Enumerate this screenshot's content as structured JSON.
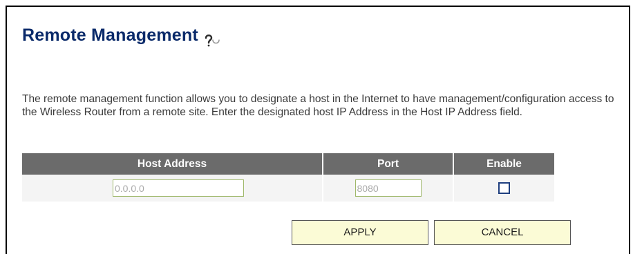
{
  "header": {
    "title": "Remote Management",
    "help_icon": "help-icon"
  },
  "description": "The remote management function allows you to designate a host in the Internet to have management/configuration access to the Wireless Router from a remote site. Enter the designated host IP Address in the Host IP Address field.",
  "table": {
    "columns": [
      "Host Address",
      "Port",
      "Enable"
    ],
    "row": {
      "host_address": "0.0.0.0",
      "port": "8080",
      "enabled": false
    }
  },
  "buttons": {
    "apply_label": "APPLY",
    "cancel_label": "CANCEL"
  },
  "colors": {
    "title": "#0a2a6a",
    "table_header_bg": "#6b6b6b",
    "table_row_bg": "#f4f4f4",
    "button_bg": "#fbfbd6",
    "input_border": "#9fb86a"
  }
}
